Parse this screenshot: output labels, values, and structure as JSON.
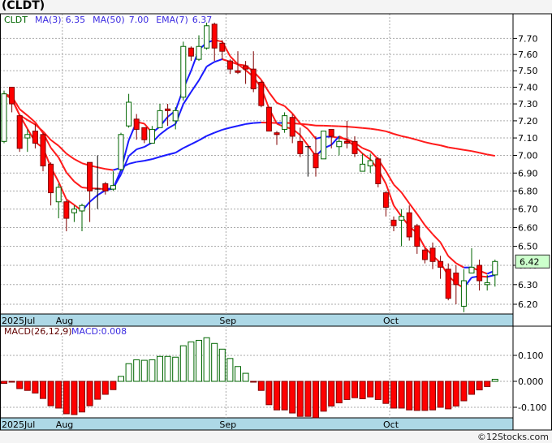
{
  "symbol_title": "(CLDT)",
  "legend": {
    "ticker": "CLDT",
    "ma3_label": "MA(3)",
    "ma3_value": "6.35",
    "ma50_label": "MA(50)",
    "ma50_value": "7.00",
    "ema7_label": "EMA(7)",
    "ema7_value": "6.37"
  },
  "macd_legend": {
    "label": "MACD(26,12,9)",
    "value_label": "MACD:0.008"
  },
  "last_price": "6.42",
  "footer": "©12Stocks.com",
  "colors": {
    "up": "#006600",
    "down": "#ff0000",
    "rising_line": "#1a1aff",
    "falling_line": "#ff1a1a",
    "axis_band": "#add8e6",
    "price_tag": "#ccffcc"
  },
  "chart_data": [
    {
      "type": "candlestick",
      "scale": "log",
      "grid": true,
      "ylim": [
        6.15,
        7.82
      ],
      "y_ticks": [
        "7.70",
        "7.60",
        "7.50",
        "7.40",
        "7.30",
        "7.20",
        "7.10",
        "7.00",
        "6.90",
        "6.80",
        "6.70",
        "6.60",
        "6.50",
        "6.40",
        "6.30",
        "6.20"
      ],
      "x_ticks": [
        {
          "label": "2025Jul",
          "index": 0
        },
        {
          "label": "Aug",
          "index": 8
        },
        {
          "label": "Sep",
          "index": 29
        },
        {
          "label": "Oct",
          "index": 50
        }
      ],
      "overlays": [
        "MA(3)",
        "MA(50)",
        "EMA(7)"
      ],
      "ohlc": [
        [
          7.08,
          7.38,
          7.07,
          7.36
        ],
        [
          7.4,
          7.4,
          7.25,
          7.3
        ],
        [
          7.23,
          7.23,
          7.02,
          7.04
        ],
        [
          7.1,
          7.15,
          7.02,
          7.12
        ],
        [
          7.14,
          7.18,
          7.04,
          7.07
        ],
        [
          7.12,
          7.13,
          6.91,
          6.94
        ],
        [
          6.95,
          6.96,
          6.72,
          6.79
        ],
        [
          6.74,
          6.84,
          6.65,
          6.82
        ],
        [
          6.74,
          6.75,
          6.58,
          6.65
        ],
        [
          6.68,
          6.72,
          6.63,
          6.7
        ],
        [
          6.69,
          6.73,
          6.58,
          6.72
        ],
        [
          6.96,
          6.96,
          6.63,
          6.8
        ],
        [
          6.81,
          7.0,
          6.7,
          6.81
        ],
        [
          6.84,
          6.85,
          6.78,
          6.8
        ],
        [
          6.81,
          6.91,
          6.8,
          6.83
        ],
        [
          6.92,
          7.13,
          6.91,
          7.12
        ],
        [
          7.17,
          7.36,
          7.16,
          7.31
        ],
        [
          7.21,
          7.24,
          7.09,
          7.15
        ],
        [
          7.16,
          7.16,
          7.07,
          7.09
        ],
        [
          7.07,
          7.17,
          7.07,
          7.15
        ],
        [
          7.16,
          7.3,
          7.16,
          7.26
        ],
        [
          7.27,
          7.3,
          7.17,
          7.26
        ],
        [
          7.2,
          7.28,
          7.15,
          7.26
        ],
        [
          7.34,
          7.68,
          7.32,
          7.65
        ],
        [
          7.64,
          7.65,
          7.56,
          7.59
        ],
        [
          7.57,
          7.72,
          7.56,
          7.65
        ],
        [
          7.64,
          7.8,
          7.63,
          7.78
        ],
        [
          7.79,
          7.8,
          7.56,
          7.64
        ],
        [
          7.67,
          7.69,
          7.57,
          7.62
        ],
        [
          7.56,
          7.57,
          7.48,
          7.51
        ],
        [
          7.5,
          7.62,
          7.48,
          7.49
        ],
        [
          7.53,
          7.56,
          7.42,
          7.51
        ],
        [
          7.51,
          7.62,
          7.37,
          7.39
        ],
        [
          7.43,
          7.44,
          7.28,
          7.29
        ],
        [
          7.28,
          7.28,
          7.14,
          7.14
        ],
        [
          7.13,
          7.14,
          7.06,
          7.12
        ],
        [
          7.15,
          7.25,
          7.13,
          7.23
        ],
        [
          7.22,
          7.24,
          7.07,
          7.11
        ],
        [
          7.08,
          7.16,
          6.99,
          7.01
        ],
        [
          7.05,
          7.05,
          6.88,
          7.05
        ],
        [
          7.01,
          7.11,
          6.88,
          6.93
        ],
        [
          6.98,
          7.14,
          6.98,
          7.14
        ],
        [
          7.15,
          7.15,
          7.04,
          7.11
        ],
        [
          7.05,
          7.11,
          7.0,
          7.08
        ],
        [
          7.08,
          7.2,
          7.04,
          7.07
        ],
        [
          7.08,
          7.11,
          6.99,
          7.01
        ],
        [
          6.91,
          7.01,
          6.91,
          6.95
        ],
        [
          6.94,
          7.01,
          6.9,
          6.97
        ],
        [
          6.98,
          6.99,
          6.82,
          6.84
        ],
        [
          6.79,
          6.8,
          6.66,
          6.71
        ],
        [
          6.64,
          6.66,
          6.58,
          6.61
        ],
        [
          6.64,
          6.7,
          6.5,
          6.66
        ],
        [
          6.68,
          6.72,
          6.53,
          6.55
        ],
        [
          6.61,
          6.62,
          6.46,
          6.5
        ],
        [
          6.48,
          6.49,
          6.41,
          6.43
        ],
        [
          6.49,
          6.52,
          6.38,
          6.42
        ],
        [
          6.42,
          6.45,
          6.33,
          6.39
        ],
        [
          6.38,
          6.41,
          6.22,
          6.23
        ],
        [
          6.36,
          6.4,
          6.2,
          6.3
        ],
        [
          6.19,
          6.38,
          6.16,
          6.32
        ],
        [
          6.36,
          6.49,
          6.36,
          6.39
        ],
        [
          6.4,
          6.43,
          6.27,
          6.32
        ],
        [
          6.3,
          6.35,
          6.27,
          6.31
        ],
        [
          6.35,
          6.43,
          6.29,
          6.42
        ]
      ]
    },
    {
      "type": "bar",
      "title": "MACD(26,12,9)",
      "ylim": [
        -0.16,
        0.2
      ],
      "y_ticks": [
        "0.100",
        "0.000",
        "-0.100"
      ],
      "values": [
        -0.008,
        -0.001,
        -0.028,
        -0.035,
        -0.045,
        -0.066,
        -0.094,
        -0.103,
        -0.125,
        -0.128,
        -0.118,
        -0.094,
        -0.069,
        -0.05,
        -0.032,
        0.019,
        0.068,
        0.083,
        0.081,
        0.083,
        0.096,
        0.096,
        0.093,
        0.137,
        0.152,
        0.158,
        0.168,
        0.146,
        0.124,
        0.088,
        0.057,
        0.031,
        -0.001,
        -0.035,
        -0.09,
        -0.11,
        -0.11,
        -0.122,
        -0.135,
        -0.135,
        -0.14,
        -0.115,
        -0.095,
        -0.083,
        -0.07,
        -0.063,
        -0.067,
        -0.06,
        -0.07,
        -0.085,
        -0.103,
        -0.103,
        -0.11,
        -0.112,
        -0.112,
        -0.11,
        -0.1,
        -0.106,
        -0.095,
        -0.075,
        -0.05,
        -0.033,
        -0.02,
        0.008
      ]
    }
  ]
}
